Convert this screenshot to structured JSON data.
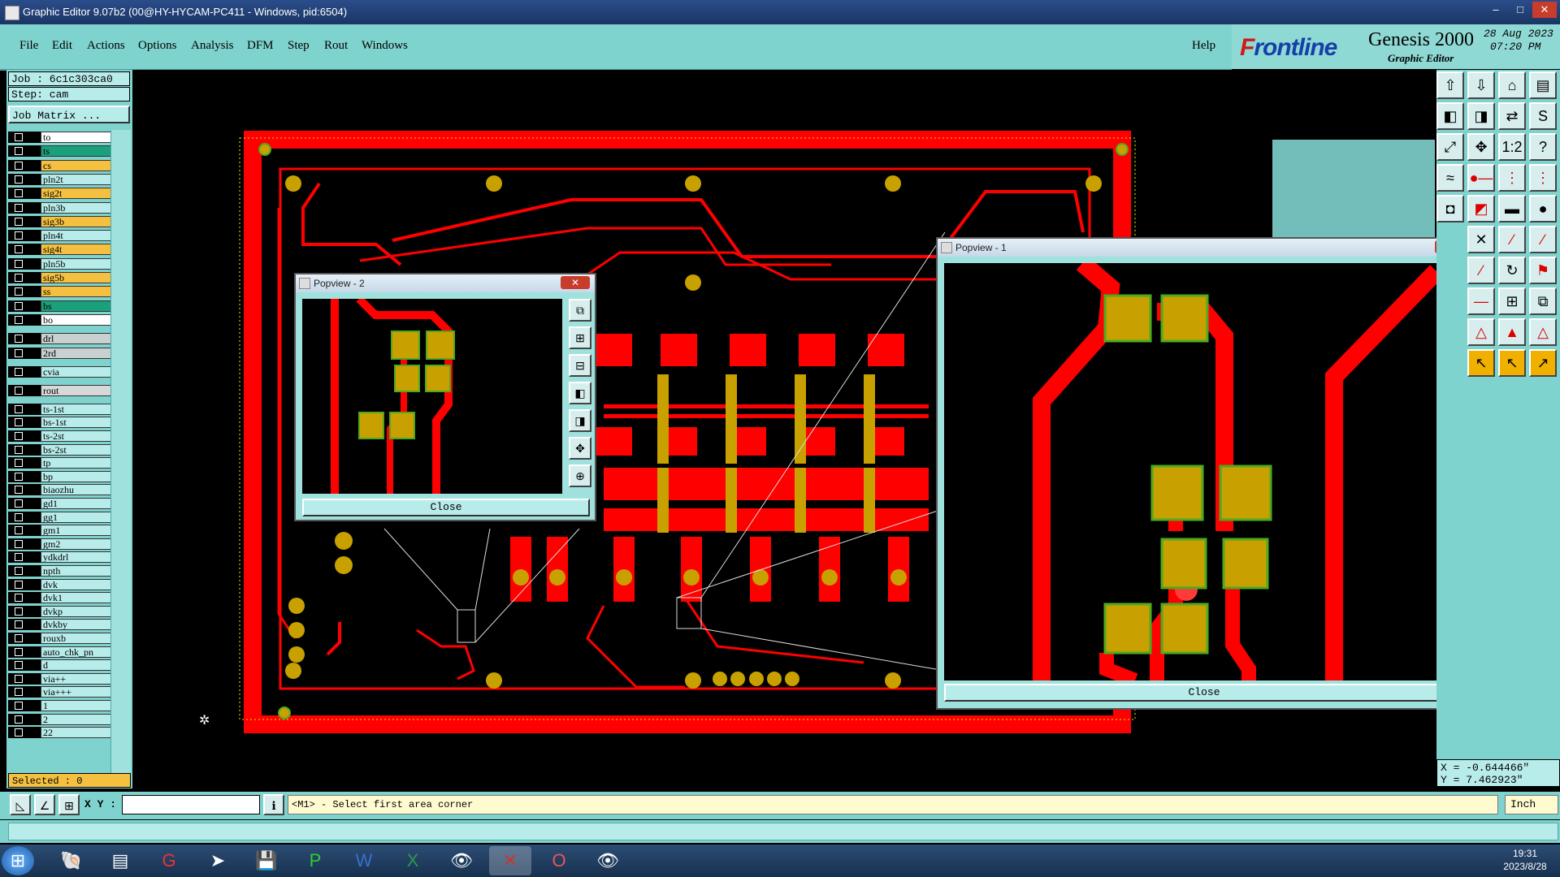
{
  "window": {
    "title": "Graphic Editor 9.07b2 (00@HY-HYCAM-PC411 - Windows, pid:6504)",
    "min": "–",
    "max": "□",
    "close": "✕"
  },
  "menu": [
    "File",
    "Edit",
    "Actions",
    "Options",
    "Analysis",
    "DFM",
    "Step",
    "Rout",
    "Windows"
  ],
  "help_label": "Help",
  "brand": {
    "logo_f": "F",
    "logo_rest": "rontline",
    "product": "Genesis 2000",
    "subtitle": "Graphic Editor",
    "date": "28 Aug 2023",
    "time": "07:20 PM"
  },
  "job": {
    "job_label": "Job  :  6c1c303ca0",
    "step_label": "Step: cam",
    "matrix_button": "Job Matrix ..."
  },
  "layers": [
    {
      "name": "to",
      "color": "#ffffff"
    },
    {
      "name": "ts",
      "color": "#1aa07a"
    },
    {
      "name": "cs",
      "color": "#f5c040"
    },
    {
      "name": "pln2t",
      "color": "#b8ecea"
    },
    {
      "name": "sig2t",
      "color": "#f5c040"
    },
    {
      "name": "pln3b",
      "color": "#b8ecea"
    },
    {
      "name": "sig3b",
      "color": "#f5c040"
    },
    {
      "name": "pln4t",
      "color": "#b8ecea"
    },
    {
      "name": "sig4t",
      "color": "#f5c040"
    },
    {
      "name": "pln5b",
      "color": "#b8ecea"
    },
    {
      "name": "sig5b",
      "color": "#f5c040"
    },
    {
      "name": "ss",
      "color": "#f5c040"
    },
    {
      "name": "bs",
      "color": "#1aa07a"
    },
    {
      "name": "bo",
      "color": "#ffffff"
    },
    {
      "name": "drl",
      "color": "#c8d0d0"
    },
    {
      "name": "2rd",
      "color": "#c8d0d0"
    },
    {
      "name": "cvia",
      "color": "#b8ecea"
    },
    {
      "name": "rout",
      "color": "#d8d8d8"
    },
    {
      "name": "ts-1st",
      "color": "#b8ecea"
    },
    {
      "name": "bs-1st",
      "color": "#b8ecea"
    },
    {
      "name": "ts-2st",
      "color": "#b8ecea"
    },
    {
      "name": "bs-2st",
      "color": "#b8ecea"
    },
    {
      "name": "tp",
      "color": "#b8ecea"
    },
    {
      "name": "bp",
      "color": "#b8ecea"
    },
    {
      "name": "biaozhu",
      "color": "#b8ecea"
    },
    {
      "name": "gd1",
      "color": "#b8ecea"
    },
    {
      "name": "gg1",
      "color": "#b8ecea"
    },
    {
      "name": "gm1",
      "color": "#b8ecea"
    },
    {
      "name": "gm2",
      "color": "#b8ecea"
    },
    {
      "name": "ydkdrl",
      "color": "#b8ecea"
    },
    {
      "name": "npth",
      "color": "#b8ecea"
    },
    {
      "name": "dvk",
      "color": "#b8ecea"
    },
    {
      "name": "dvk1",
      "color": "#b8ecea"
    },
    {
      "name": "dvkp",
      "color": "#b8ecea"
    },
    {
      "name": "dvkby",
      "color": "#b8ecea"
    },
    {
      "name": "rouxb",
      "color": "#b8ecea"
    },
    {
      "name": "auto_chk_pn",
      "color": "#b8ecea"
    },
    {
      "name": "d",
      "color": "#b8ecea"
    },
    {
      "name": "via++",
      "color": "#b8ecea"
    },
    {
      "name": "via+++",
      "color": "#b8ecea"
    },
    {
      "name": "1",
      "color": "#b8ecea"
    },
    {
      "name": "2",
      "color": "#b8ecea"
    },
    {
      "name": "22",
      "color": "#b8ecea"
    }
  ],
  "selected_label": "Selected : 0",
  "status": {
    "xy_label": "X Y :",
    "prompt": "<M1> - Select first area corner",
    "units": "Inch"
  },
  "coords": {
    "x": "X = -0.644466\"",
    "y": "Y = 7.462923\""
  },
  "popview1": {
    "title": "Popview - 1",
    "close_label": "Close"
  },
  "popview2": {
    "title": "Popview - 2",
    "close_label": "Close"
  },
  "clock": {
    "time": "19:31",
    "date": "2023/8/28"
  },
  "colors": {
    "copper": "#ff0000",
    "pad": "#c8a000",
    "pad_outline": "#4caa20",
    "background": "#000000",
    "panel": "#7fd3ce"
  }
}
